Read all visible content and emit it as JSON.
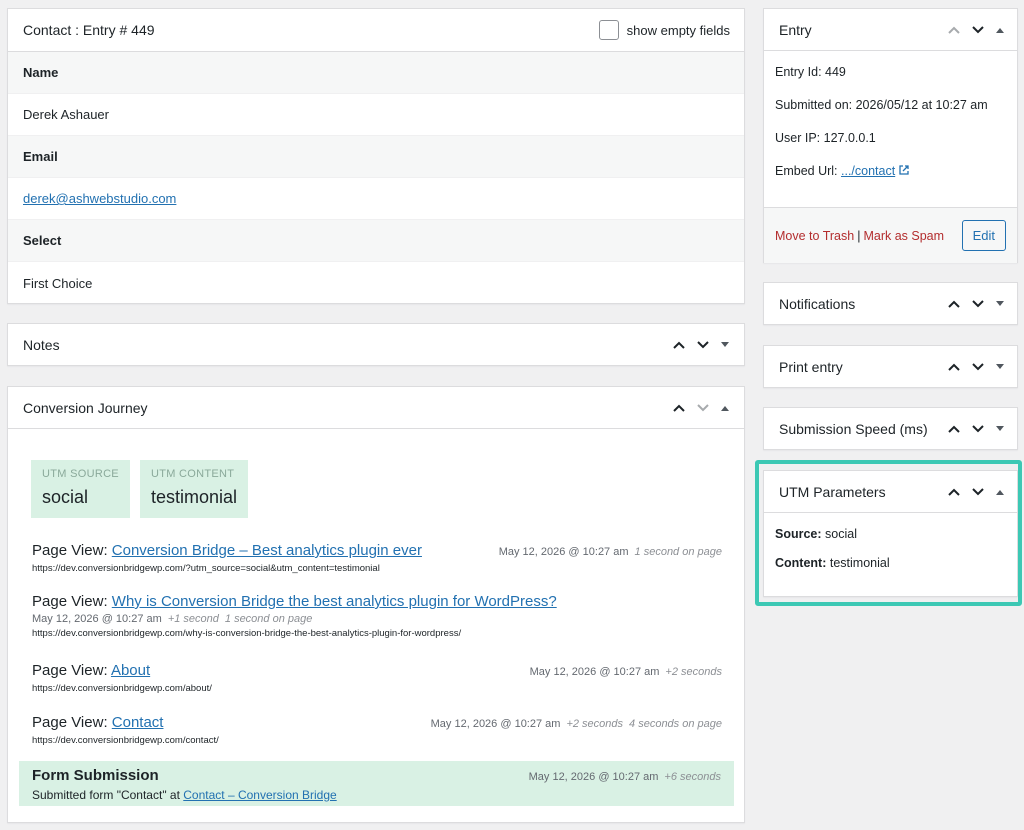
{
  "contact": {
    "title": "Contact : Entry # 449",
    "show_empty_label": "show empty fields",
    "fields": [
      {
        "label": "Name",
        "value": "Derek Ashauer"
      },
      {
        "label": "Email",
        "value": "derek@ashwebstudio.com"
      },
      {
        "label": "Select",
        "value": "First Choice"
      }
    ]
  },
  "notes": {
    "title": "Notes"
  },
  "journey": {
    "title": "Conversion Journey",
    "utm_tags": [
      {
        "key": "UTM SOURCE",
        "value": "social"
      },
      {
        "key": "UTM CONTENT",
        "value": "testimonial"
      }
    ],
    "events": [
      {
        "prefix": "Page View:",
        "link": "Conversion Bridge – Best analytics plugin ever",
        "date": "May 12, 2026 @ 10:27 am",
        "delta": "",
        "time_on_page": "1 second on page",
        "url": "https://dev.conversionbridgewp.com/?utm_source=social&utm_content=testimonial"
      },
      {
        "prefix": "Page View:",
        "link": "Why is Conversion Bridge the best analytics plugin for WordPress?",
        "date": "May 12, 2026 @ 10:27 am",
        "delta": "+1 second",
        "time_on_page": "1 second on page",
        "url": "https://dev.conversionbridgewp.com/why-is-conversion-bridge-the-best-analytics-plugin-for-wordpress/"
      },
      {
        "prefix": "Page View:",
        "link": "About",
        "date": "May 12, 2026 @ 10:27 am",
        "delta": "+2 seconds",
        "time_on_page": "",
        "url": "https://dev.conversionbridgewp.com/about/"
      },
      {
        "prefix": "Page View:",
        "link": "Contact",
        "date": "May 12, 2026 @ 10:27 am",
        "delta": "+2 seconds",
        "time_on_page": "4 seconds on page",
        "url": "https://dev.conversionbridgewp.com/contact/"
      }
    ],
    "form_submission": {
      "title": "Form Submission",
      "date": "May 12, 2026 @ 10:27 am",
      "delta": "+6 seconds",
      "text": "Submitted form \"Contact\" at",
      "link": "Contact – Conversion Bridge"
    }
  },
  "entry": {
    "title": "Entry",
    "entry_id": "Entry Id: 449",
    "submitted": "Submitted on: 2026/05/12 at 10:27 am",
    "user_ip": "User IP: 127.0.0.1",
    "embed_label": "Embed Url:",
    "embed_link": ".../contact",
    "trash": "Move to Trash",
    "separator": "|",
    "spam": "Mark as Spam",
    "edit": "Edit"
  },
  "sidebar_boxes": {
    "notifications": "Notifications",
    "print": "Print entry",
    "speed": "Submission Speed (ms)"
  },
  "utm_params": {
    "title": "UTM Parameters",
    "source_label": "Source:",
    "source_value": "social",
    "content_label": "Content:",
    "content_value": "testimonial"
  },
  "colors": {
    "accent": "#2271b1",
    "highlight": "#3cc8b4",
    "utm_bg": "#d9f1e4",
    "danger": "#b32d2e"
  }
}
